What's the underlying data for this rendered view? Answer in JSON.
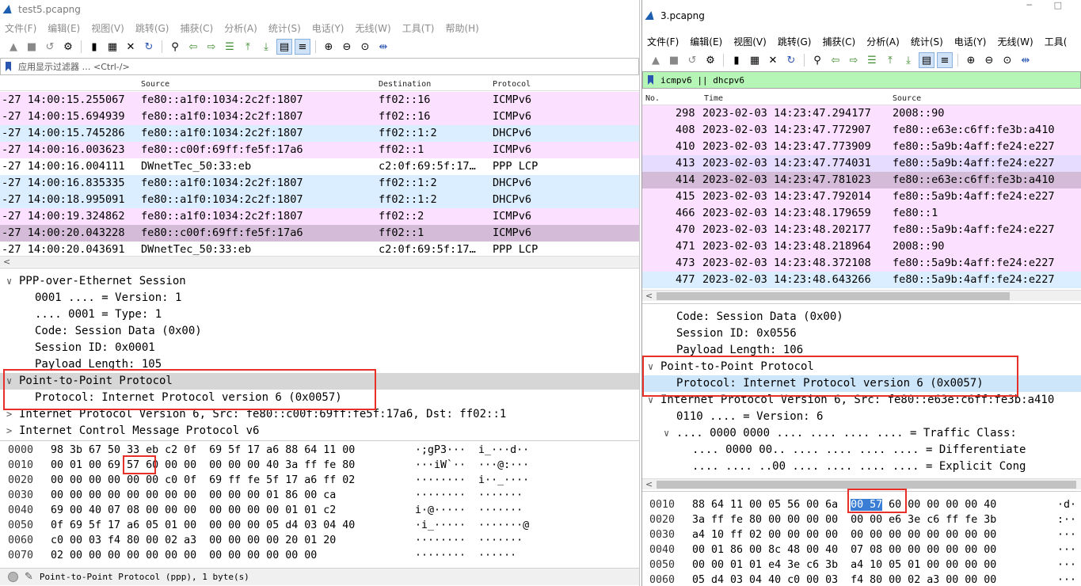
{
  "left": {
    "title": "test5.pcapng",
    "menu": [
      "文件(F)",
      "编辑(E)",
      "视图(V)",
      "跳转(G)",
      "捕获(C)",
      "分析(A)",
      "统计(S)",
      "电话(Y)",
      "无线(W)",
      "工具(T)",
      "帮助(H)"
    ],
    "filter_placeholder": "应用显示过滤器 … <Ctrl-/>",
    "columns": [
      "Source",
      "Destination",
      "Protocol"
    ],
    "packets": [
      {
        "time": "-27 14:00:15.255067",
        "src": "fe80::a1f0:1034:2c2f:1807",
        "dst": "ff02::16",
        "proto": "ICMPv6",
        "bg": "#fce0ff"
      },
      {
        "time": "-27 14:00:15.694939",
        "src": "fe80::a1f0:1034:2c2f:1807",
        "dst": "ff02::16",
        "proto": "ICMPv6",
        "bg": "#fce0ff"
      },
      {
        "time": "-27 14:00:15.745286",
        "src": "fe80::a1f0:1034:2c2f:1807",
        "dst": "ff02::1:2",
        "proto": "DHCPv6",
        "bg": "#daeeff"
      },
      {
        "time": "-27 14:00:16.003623",
        "src": "fe80::c00f:69ff:fe5f:17a6",
        "dst": "ff02::1",
        "proto": "ICMPv6",
        "bg": "#fce0ff"
      },
      {
        "time": "-27 14:00:16.004111",
        "src": "DWnetTec_50:33:eb",
        "dst": "c2:0f:69:5f:17…",
        "proto": "PPP LCP",
        "bg": "#ffffff"
      },
      {
        "time": "-27 14:00:16.835335",
        "src": "fe80::a1f0:1034:2c2f:1807",
        "dst": "ff02::1:2",
        "proto": "DHCPv6",
        "bg": "#daeeff"
      },
      {
        "time": "-27 14:00:18.995091",
        "src": "fe80::a1f0:1034:2c2f:1807",
        "dst": "ff02::1:2",
        "proto": "DHCPv6",
        "bg": "#daeeff"
      },
      {
        "time": "-27 14:00:19.324862",
        "src": "fe80::a1f0:1034:2c2f:1807",
        "dst": "ff02::2",
        "proto": "ICMPv6",
        "bg": "#fce0ff"
      },
      {
        "time": "-27 14:00:20.043228",
        "src": "fe80::c00f:69ff:fe5f:17a6",
        "dst": "ff02::1",
        "proto": "ICMPv6",
        "bg": "#d4bcd8"
      },
      {
        "time": "-27 14:00:20.043691",
        "src": "DWnetTec_50:33:eb",
        "dst": "c2:0f:69:5f:17…",
        "proto": "PPP LCP",
        "bg": "#ffffff"
      }
    ],
    "details": [
      {
        "text": "PPP-over-Ethernet Session",
        "indent": 0,
        "expander": "∨",
        "bg": "#ffffff"
      },
      {
        "text": "0001 .... = Version: 1",
        "indent": 1,
        "expander": "",
        "bg": "#ffffff"
      },
      {
        "text": ".... 0001 = Type: 1",
        "indent": 1,
        "expander": "",
        "bg": "#ffffff"
      },
      {
        "text": "Code: Session Data (0x00)",
        "indent": 1,
        "expander": "",
        "bg": "#ffffff"
      },
      {
        "text": "Session ID: 0x0001",
        "indent": 1,
        "expander": "",
        "bg": "#ffffff"
      },
      {
        "text": "Payload Length: 105",
        "indent": 1,
        "expander": "",
        "bg": "#ffffff"
      },
      {
        "text": "Point-to-Point Protocol",
        "indent": 0,
        "expander": "∨",
        "bg": "#d6d6d6"
      },
      {
        "text": "Protocol: Internet Protocol version 6 (0x0057)",
        "indent": 1,
        "expander": "",
        "bg": "#ffffff"
      },
      {
        "text": "Internet Protocol Version 6, Src: fe80::c00f:69ff:fe5f:17a6, Dst: ff02::1",
        "indent": 0,
        "expander": ">",
        "bg": "#ffffff"
      },
      {
        "text": "Internet Control Message Protocol v6",
        "indent": 0,
        "expander": ">",
        "bg": "#ffffff"
      }
    ],
    "bytes": [
      {
        "off": "0000",
        "hex": "98 3b 67 50 33 eb c2 0f  69 5f 17 a6 88 64 11 00",
        "ascii": "·;gP3···  i_···d··"
      },
      {
        "off": "0010",
        "hex": "00 01 00 69 57 60 00 00  00 00 00 40 3a ff fe 80",
        "ascii": "···iW`··  ···@:···"
      },
      {
        "off": "0020",
        "hex": "00 00 00 00 00 00 c0 0f  69 ff fe 5f 17 a6 ff 02",
        "ascii": "········  i··_····"
      },
      {
        "off": "0030",
        "hex": "00 00 00 00 00 00 00 00  00 00 00 01 86 00 ca",
        "ascii": "········  ·······"
      },
      {
        "off": "0040",
        "hex": "69 00 40 07 08 00 00 00  00 00 00 00 01 01 c2",
        "ascii": "i·@·····  ·······"
      },
      {
        "off": "0050",
        "hex": "0f 69 5f 17 a6 05 01 00  00 00 00 05 d4 03 04 40",
        "ascii": "·i_·····  ·······@"
      },
      {
        "off": "0060",
        "hex": "c0 00 03 f4 80 00 02 a3  00 00 00 00 20 01 20",
        "ascii": "········  ·······"
      },
      {
        "off": "0070",
        "hex": "02 00 00 00 00 00 00 00  00 00 00 00 00 00",
        "ascii": "········  ······"
      }
    ],
    "status": "Point-to-Point Protocol (ppp), 1 byte(s)"
  },
  "right": {
    "title": "3.pcapng",
    "menu": [
      "文件(F)",
      "编辑(E)",
      "视图(V)",
      "跳转(G)",
      "捕获(C)",
      "分析(A)",
      "统计(S)",
      "电话(Y)",
      "无线(W)",
      "工具("
    ],
    "filter_value": "icmpv6 || dhcpv6",
    "columns": [
      "No.",
      "Time",
      "Source"
    ],
    "packets": [
      {
        "no": "298",
        "time": "2023-02-03 14:23:47.294177",
        "src": "2008::90",
        "bg": "#fce0ff"
      },
      {
        "no": "408",
        "time": "2023-02-03 14:23:47.772907",
        "src": "fe80::e63e:c6ff:fe3b:a410",
        "bg": "#fce0ff"
      },
      {
        "no": "410",
        "time": "2023-02-03 14:23:47.773909",
        "src": "fe80::5a9b:4aff:fe24:e227",
        "bg": "#fce0ff"
      },
      {
        "no": "413",
        "time": "2023-02-03 14:23:47.774031",
        "src": "fe80::5a9b:4aff:fe24:e227",
        "bg": "#e6dcff"
      },
      {
        "no": "414",
        "time": "2023-02-03 14:23:47.781023",
        "src": "fe80::e63e:c6ff:fe3b:a410",
        "bg": "#d4bcd8"
      },
      {
        "no": "415",
        "time": "2023-02-03 14:23:47.792014",
        "src": "fe80::5a9b:4aff:fe24:e227",
        "bg": "#fce0ff"
      },
      {
        "no": "466",
        "time": "2023-02-03 14:23:48.179659",
        "src": "fe80::1",
        "bg": "#fce0ff"
      },
      {
        "no": "470",
        "time": "2023-02-03 14:23:48.202177",
        "src": "fe80::5a9b:4aff:fe24:e227",
        "bg": "#fce0ff"
      },
      {
        "no": "471",
        "time": "2023-02-03 14:23:48.218964",
        "src": "2008::90",
        "bg": "#fce0ff"
      },
      {
        "no": "473",
        "time": "2023-02-03 14:23:48.372108",
        "src": "fe80::5a9b:4aff:fe24:e227",
        "bg": "#fce0ff"
      },
      {
        "no": "477",
        "time": "2023-02-03 14:23:48.643266",
        "src": "fe80::5a9b:4aff:fe24:e227",
        "bg": "#daeeff"
      }
    ],
    "details": [
      {
        "text": "Code: Session Data (0x00)",
        "indent": 1,
        "expander": "",
        "bg": "#ffffff"
      },
      {
        "text": "Session ID: 0x0556",
        "indent": 1,
        "expander": "",
        "bg": "#ffffff"
      },
      {
        "text": "Payload Length: 106",
        "indent": 1,
        "expander": "",
        "bg": "#ffffff"
      },
      {
        "text": "Point-to-Point Protocol",
        "indent": 0,
        "expander": "∨",
        "bg": "#ffffff"
      },
      {
        "text": "Protocol: Internet Protocol version 6 (0x0057)",
        "indent": 1,
        "expander": "",
        "bg": "#cde6fa"
      },
      {
        "text": "Internet Protocol Version 6, Src: fe80::e63e:c6ff:fe3b:a410",
        "indent": 0,
        "expander": "∨",
        "bg": "#ffffff"
      },
      {
        "text": "0110 .... = Version: 6",
        "indent": 1,
        "expander": "",
        "bg": "#ffffff"
      },
      {
        "text": ".... 0000 0000 .... .... .... .... = Traffic Class:",
        "indent": 1,
        "expander": "∨",
        "bg": "#ffffff"
      },
      {
        "text": ".... 0000 00.. .... .... .... .... = Differentiate",
        "indent": 2,
        "expander": "",
        "bg": "#ffffff"
      },
      {
        "text": ".... .... ..00 .... .... .... .... = Explicit Cong",
        "indent": 2,
        "expander": "",
        "bg": "#ffffff"
      }
    ],
    "bytes": [
      {
        "off": "0010",
        "pre": "88 64 11 00 05 56 00 6a  ",
        "hl": "00 57",
        "post": " 60 00 00 00 00 40",
        "ascii": "·d·"
      },
      {
        "off": "0020",
        "pre": "3a ff fe 80 00 00 00 00  00 00 e6 3e c6 ff fe 3b",
        "hl": "",
        "post": "",
        "ascii": ":··"
      },
      {
        "off": "0030",
        "pre": "a4 10 ff 02 00 00 00 00  00 00 00 00 00 00 00 00",
        "hl": "",
        "post": "",
        "ascii": "···"
      },
      {
        "off": "0040",
        "pre": "00 01 86 00 8c 48 00 40  07 08 00 00 00 00 00 00",
        "hl": "",
        "post": "",
        "ascii": "···"
      },
      {
        "off": "0050",
        "pre": "00 00 01 01 e4 3e c6 3b  a4 10 05 01 00 00 00 00",
        "hl": "",
        "post": "",
        "ascii": "···"
      },
      {
        "off": "0060",
        "pre": "05 d4 03 04 40 c0 00 03  f4 80 00 02 a3 00 00 00",
        "hl": "",
        "post": "",
        "ascii": "···"
      }
    ]
  }
}
